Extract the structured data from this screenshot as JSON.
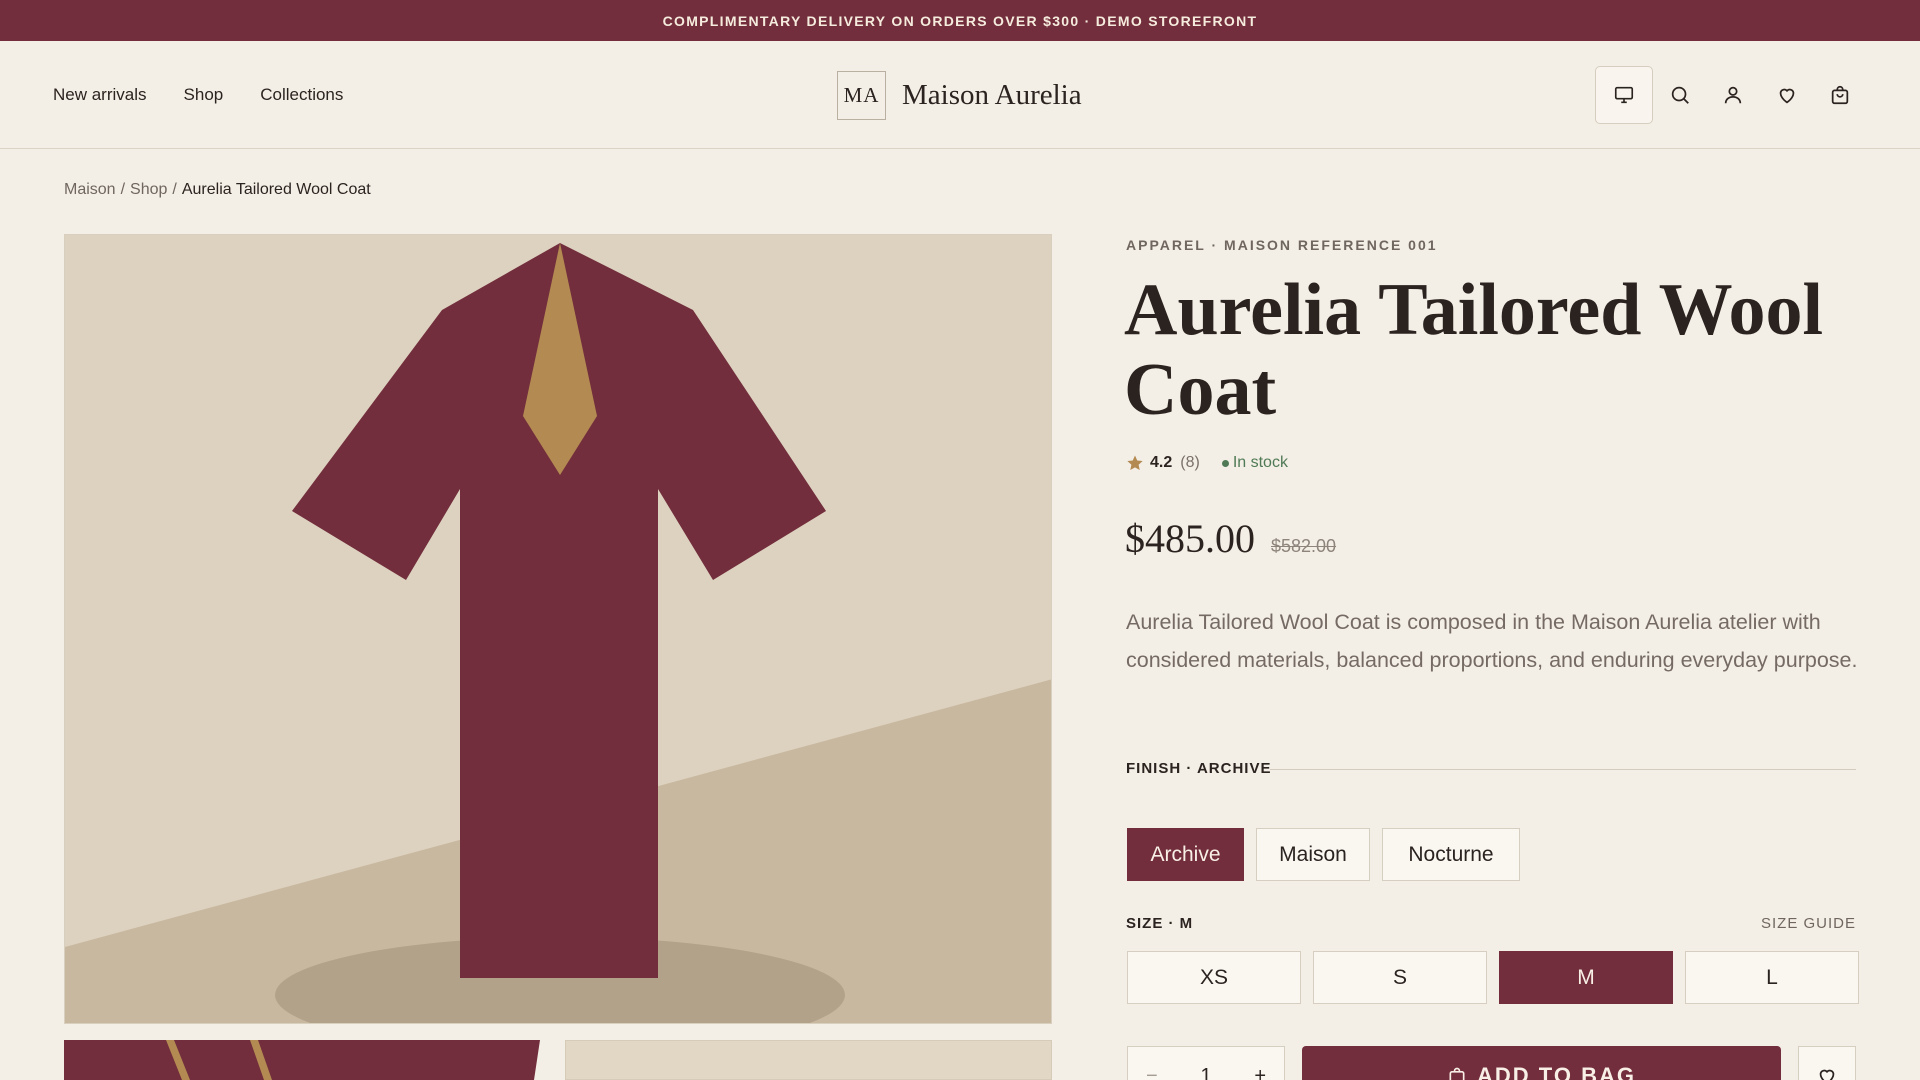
{
  "promo": {
    "text": "COMPLIMENTARY DELIVERY ON ORDERS OVER $300 · DEMO STOREFRONT"
  },
  "nav": {
    "items": [
      {
        "label": "New arrivals"
      },
      {
        "label": "Shop"
      },
      {
        "label": "Collections"
      }
    ]
  },
  "brand": {
    "monogram": "MA",
    "name": "Maison Aurelia"
  },
  "header_icons": [
    "monitor-icon",
    "search-icon",
    "user-icon",
    "heart-icon",
    "bag-icon"
  ],
  "breadcrumb": {
    "items": [
      "Maison",
      "Shop"
    ],
    "separator": "/",
    "current": "Aurelia Tailored Wool Coat"
  },
  "product": {
    "eyebrow": "APPAREL · MAISON REFERENCE 001",
    "title": "Aurelia Tailored Wool Coat",
    "rating": "4.2",
    "review_count": "(8)",
    "stock": "In stock",
    "price": "$485.00",
    "old_price": "$582.00",
    "description": "Aurelia Tailored Wool Coat is composed in the Maison Aurelia atelier with considered materials, balanced proportions, and enduring everyday purpose."
  },
  "finish": {
    "label": "FINISH · ARCHIVE",
    "options": [
      {
        "label": "Archive",
        "selected": true
      },
      {
        "label": "Maison"
      },
      {
        "label": "Nocturne"
      }
    ]
  },
  "size": {
    "label": "SIZE · M",
    "guide_label": "SIZE GUIDE",
    "options": [
      {
        "label": "XS"
      },
      {
        "label": "S"
      },
      {
        "label": "M",
        "selected": true
      },
      {
        "label": "L"
      }
    ]
  },
  "cart": {
    "quantity": "1",
    "minus": "−",
    "plus": "+",
    "add_label": "ADD TO BAG"
  },
  "colors": {
    "accent": "#722e3c",
    "background": "#f4efe6",
    "gold": "#b38a52",
    "stock_green": "#4f7a55"
  }
}
